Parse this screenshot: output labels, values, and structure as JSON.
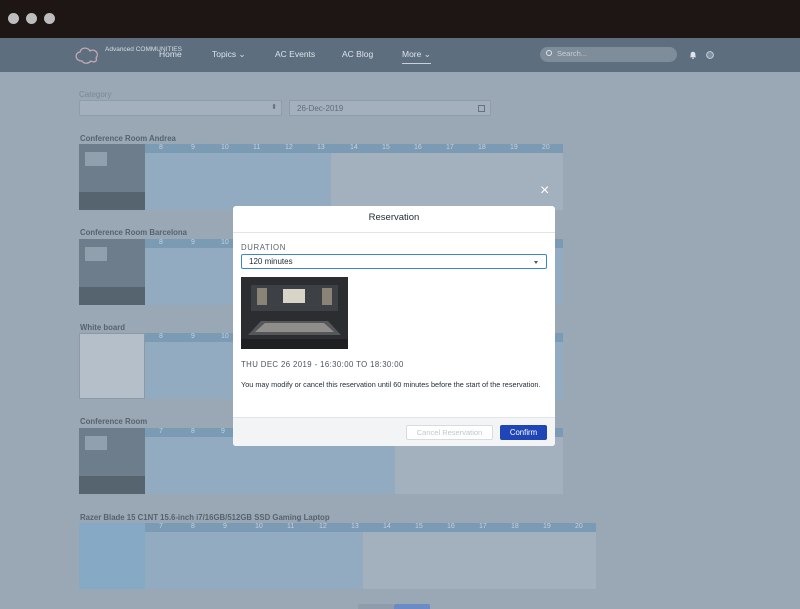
{
  "nav": {
    "logo_text": "Advanced COMMUNITIES",
    "items": [
      "Home",
      "Topics",
      "AC Events",
      "AC Blog",
      "More"
    ],
    "search_placeholder": "Search..."
  },
  "page": {
    "category_label": "Category",
    "date_value": "26-Dec-2019",
    "hours_full": [
      "8",
      "9",
      "10",
      "11",
      "12",
      "13",
      "14",
      "15",
      "16",
      "17",
      "18",
      "19",
      "20"
    ],
    "hours_from_seven": [
      "7",
      "8",
      "9",
      "10",
      "11",
      "12",
      "13",
      "14",
      "15",
      "16",
      "17",
      "18",
      "19",
      "20"
    ],
    "rooms": [
      "Conference Room Andrea",
      "Conference Room Barcelona",
      "White board",
      "Conference Room",
      "Razer Blade 15 C1NT 15.6-inch i7/16GB/512GB SSD Gaming Laptop"
    ]
  },
  "modal": {
    "title": "Reservation",
    "close_label": "×",
    "duration_label": "DURATION",
    "duration_value": "120 minutes",
    "when": "THU DEC 26 2019 - 16:30:00 TO 18:30:00",
    "notice": "You may modify or cancel this reservation until 60 minutes before the start of the reservation.",
    "cancel_label": "Cancel Reservation",
    "confirm_label": "Confirm"
  },
  "colors": {
    "accent": "#1f45b6",
    "focus": "#3c87c8",
    "overlay": "#9aa7b5"
  }
}
